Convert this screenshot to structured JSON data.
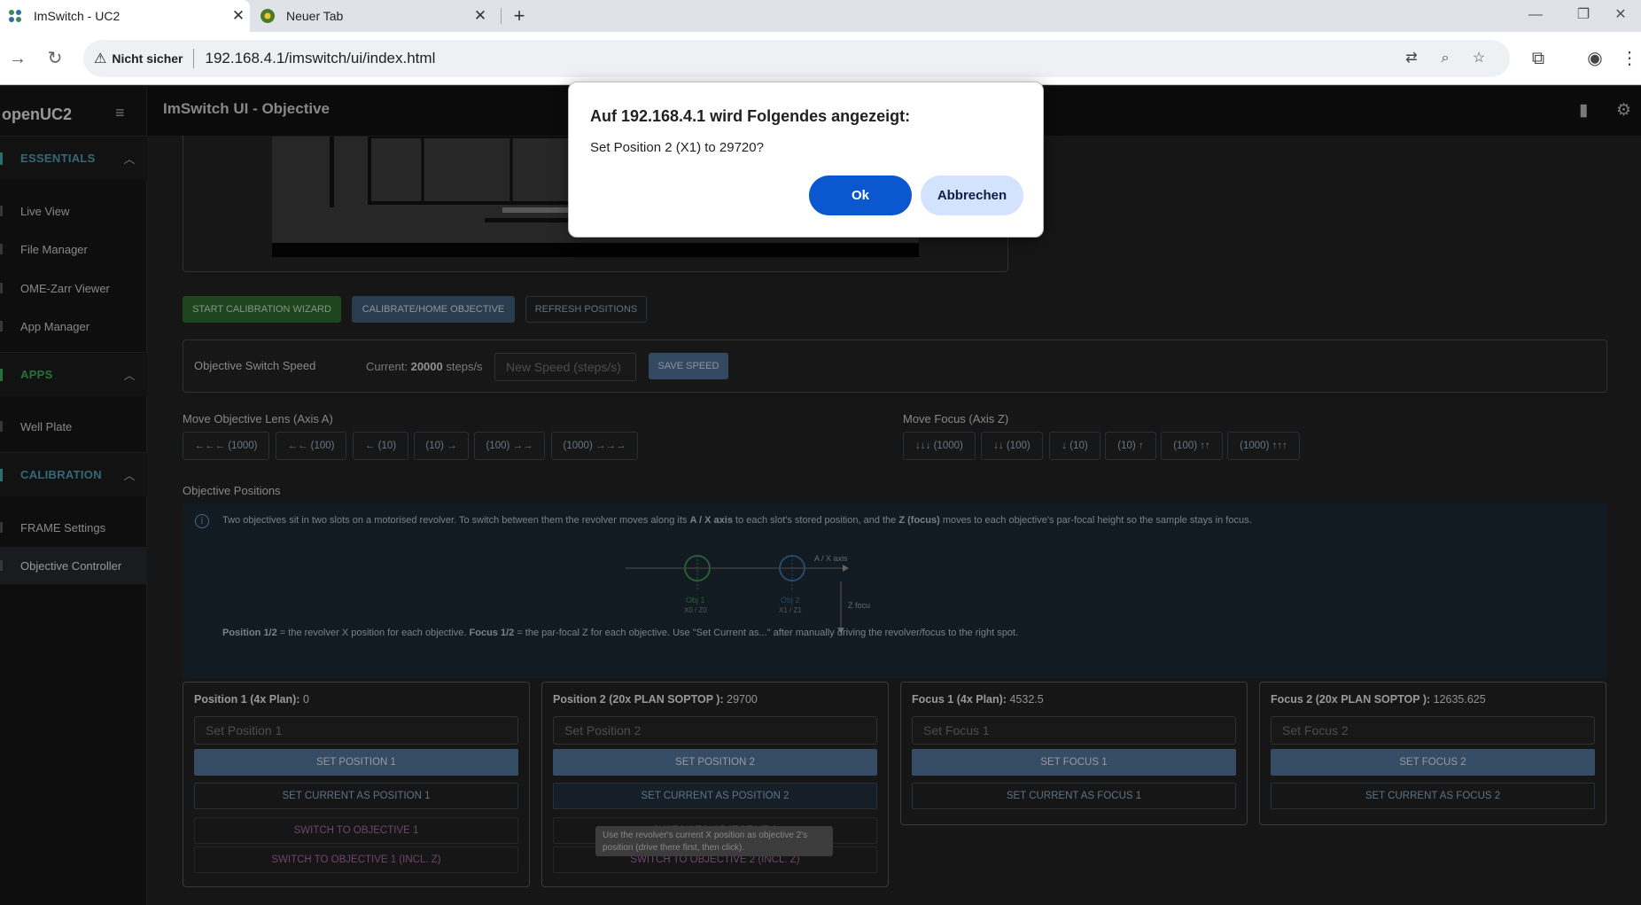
{
  "browser": {
    "tabs": [
      {
        "title": "ImSwitch - UC2",
        "active": true,
        "icon": "imswitch-favicon-icon"
      },
      {
        "title": "Neuer Tab",
        "active": false,
        "icon": "chrome-favicon-icon"
      }
    ],
    "security_label": "Nicht sicher",
    "url": "192.168.4.1/imswitch/ui/index.html"
  },
  "sidebar": {
    "brand": "openUC2",
    "sections": [
      {
        "label": "ESSENTIALS",
        "color": "#4fa0b8",
        "items": [
          "Live View",
          "File Manager",
          "OME-Zarr Viewer",
          "App Manager"
        ]
      },
      {
        "label": "APPS",
        "color": "#3fae5a",
        "items": [
          "Well Plate"
        ]
      },
      {
        "label": "CALIBRATION",
        "color": "#4fa0b8",
        "items": [
          "FRAME Settings",
          "Objective Controller"
        ]
      }
    ],
    "active_item": "Objective Controller"
  },
  "topbar": {
    "title": "ImSwitch UI - Objective"
  },
  "controls": {
    "start_wizard": "START CALIBRATION WIZARD",
    "calibrate_home": "CALIBRATE/HOME OBJECTIVE",
    "refresh": "REFRESH POSITIONS"
  },
  "speed": {
    "label": "Objective Switch Speed",
    "current_prefix": "Current:",
    "current_value": "20000",
    "current_unit": "steps/s",
    "input_placeholder": "New Speed (steps/s)",
    "save_label": "SAVE SPEED"
  },
  "move_lens": {
    "title": "Move Objective Lens (Axis A)",
    "buttons": [
      "←←← (1000)",
      "←← (100)",
      "← (10)",
      "(10) →",
      "(100) →→",
      "(1000) →→→"
    ]
  },
  "move_focus": {
    "title": "Move Focus (Axis Z)",
    "buttons": [
      "↓↓↓ (1000)",
      "↓↓ (100)",
      "↓ (10)",
      "(10) ↑",
      "(100) ↑↑",
      "(1000) ↑↑↑"
    ]
  },
  "positions": {
    "title": "Objective Positions",
    "info_pre": "Two objectives sit in two slots on a motorised revolver. To switch between them the revolver moves along its ",
    "info_axis": "A / X axis",
    "info_mid": " to each slot's stored position, and the ",
    "info_z": "Z (focus)",
    "info_post": " moves to each objective's par-focal height so the sample stays in focus.",
    "diagram": {
      "axis_label": "A / X axis",
      "z_label": "Z focu",
      "obj1": "Obj 1",
      "obj1_sub": "X0 / Z0",
      "obj2": "Obj 2",
      "obj2_sub": "X1 / Z1"
    },
    "note_pos": "Position 1/2",
    "note_mid": " = the revolver X position for each objective. ",
    "note_focus": "Focus 1/2",
    "note_post": " = the par-focal Z for each objective. Use \"Set Current as...\" after manually driving the revolver/focus to the right spot."
  },
  "cards": [
    {
      "label": "Position 1 (4x Plan):",
      "value": "0",
      "placeholder": "Set Position 1",
      "set": "SET POSITION 1",
      "current": "SET CURRENT AS POSITION 1",
      "switch": "SWITCH TO OBJECTIVE 1",
      "switch_z": "SWITCH TO OBJECTIVE 1 (INCL. Z)"
    },
    {
      "label": "Position 2 (20x PLAN SOPTOP ):",
      "value": "29700",
      "placeholder": "Set Position 2",
      "set": "SET POSITION 2",
      "current": "SET CURRENT AS POSITION 2",
      "switch": "SWITCH TO OBJECTIVE 2",
      "switch_z": "SWITCH TO OBJECTIVE 2 (INCL. Z)"
    },
    {
      "label": "Focus 1 (4x Plan):",
      "value": "4532.5",
      "placeholder": "Set Focus 1",
      "set": "SET FOCUS 1",
      "current": "SET CURRENT AS FOCUS 1"
    },
    {
      "label": "Focus 2 (20x PLAN SOPTOP ):",
      "value": "12635.625",
      "placeholder": "Set Focus 2",
      "set": "SET FOCUS 2",
      "current": "SET CURRENT AS FOCUS 2"
    }
  ],
  "tooltip": "Use the revolver's current X position as objective 2's position (drive there first, then click).",
  "dialog": {
    "title": "Auf 192.168.4.1 wird Folgendes angezeigt:",
    "message": "Set Position 2 (X1) to 29720?",
    "ok": "Ok",
    "cancel": "Abbrechen"
  }
}
